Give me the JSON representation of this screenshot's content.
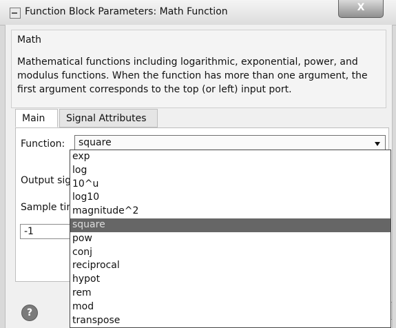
{
  "window": {
    "title": "Function Block Parameters: Math Function",
    "close_label": "X"
  },
  "group": {
    "title": "Math",
    "description": "Mathematical functions including logarithmic, exponential, power, and modulus functions.  When the function has more than one argument, the first argument corresponds to the top (or left) input port."
  },
  "tabs": [
    {
      "label": "Main"
    },
    {
      "label": "Signal Attributes"
    }
  ],
  "form": {
    "function_label": "Function:",
    "function_value": "square",
    "output_signal_label": "Output sig",
    "sample_time_label": "Sample tin",
    "sample_time_value": "-1"
  },
  "dropdown": {
    "options": [
      "exp",
      "log",
      "10^u",
      "log10",
      "magnitude^2",
      "square",
      "pow",
      "conj",
      "reciprocal",
      "hypot",
      "rem",
      "mod",
      "transpose"
    ],
    "selected": "square"
  },
  "footer": {
    "help_label": "?"
  },
  "colors": {
    "selected_option": "#666666",
    "panel_background": "#f0f0f0"
  }
}
